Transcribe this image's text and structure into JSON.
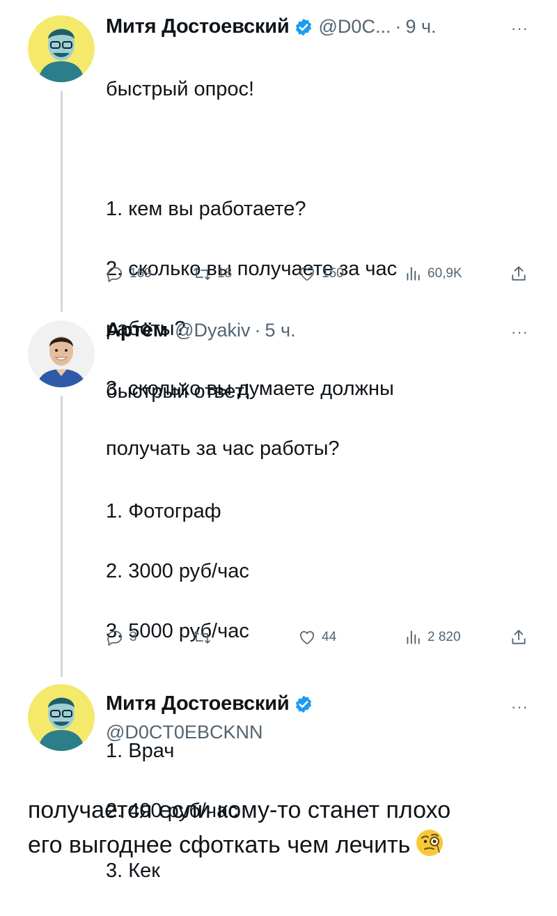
{
  "tweets": [
    {
      "author_name": "Митя Достоевский",
      "handle": "@D0C...",
      "time": "9 ч.",
      "text": "быстрый опрос!\n\n1. кем вы работаете?\n2. сколько вы получаете за час работы?\n3. сколько вы думаете должны получать за час работы?",
      "text_lines": [
        "быстрый опрос!",
        "",
        "1. кем вы работаете?",
        "2. сколько вы получаете за час",
        "работы?",
        "3. сколько вы думаете должны",
        "получать за час работы?"
      ],
      "replies": "169",
      "retweets": "18",
      "likes": "150",
      "views": "60,9K"
    },
    {
      "author_name": "Артём",
      "handle": "@Dyakiv",
      "time": "5 ч.",
      "text_lines": [
        "быстрый ответ!",
        "",
        "1. Фотограф",
        "2. 3000 руб/час",
        "3. 5000 руб/час",
        "",
        "1. Врач",
        "2. 400 руб/час",
        "3. Кек"
      ],
      "replies": "3",
      "retweets": "",
      "likes": "44",
      "views": "2 820"
    },
    {
      "author_name": "Митя Достоевский",
      "handle": "@D0CT0EBCKNN",
      "text": "получается если кому-то станет плохо\nего выгоднее сфоткать чем лечить"
    }
  ],
  "icons": {
    "reply": "reply-icon",
    "retweet": "retweet-icon",
    "like": "heart-icon",
    "views": "views-icon",
    "share": "share-icon",
    "verified": "verified-badge-icon",
    "more": "more-icon",
    "emoji": "face-with-monocle-emoji"
  },
  "colors": {
    "verified_blue": "#1d9bf0",
    "muted": "#536471",
    "thread_line": "#cfd9de",
    "avatar_yellow": "#f4e96b"
  },
  "more_label": "···",
  "separator": "·"
}
